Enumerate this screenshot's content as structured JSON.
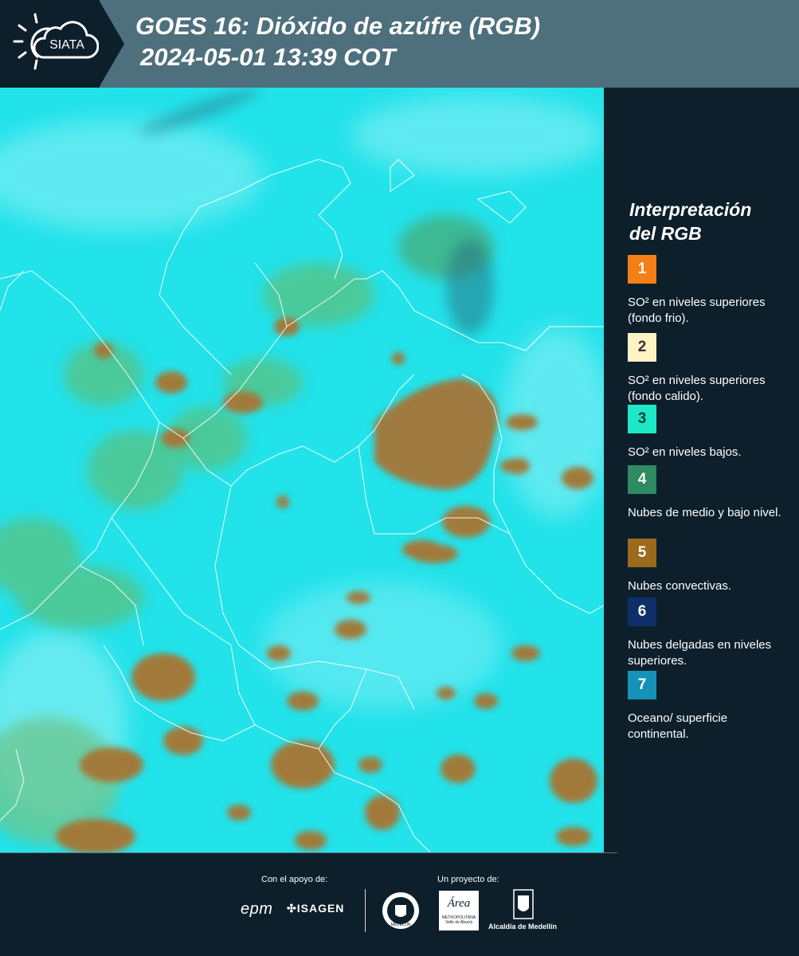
{
  "header": {
    "logo_text": "SIATA",
    "title": "GOES 16: Dióxido de azúfre (RGB)",
    "subtitle": "2024-05-01 13:39 COT"
  },
  "legend": {
    "title_line1": "Interpretación",
    "title_line2": "del RGB",
    "items": [
      {
        "number": "1",
        "color": "#f57f17",
        "text_color": "#ffffff",
        "label": "SO² en niveles superiores (fondo frio)."
      },
      {
        "number": "2",
        "color": "#fff3c4",
        "text_color": "#333333",
        "label": "SO² en niveles superiores (fondo calido)."
      },
      {
        "number": "3",
        "color": "#1de9c8",
        "text_color": "#1a3a3a",
        "label": "SO² en niveles bajos."
      },
      {
        "number": "4",
        "color": "#2e8b62",
        "text_color": "#ffffff",
        "label": "Nubes de medio y bajo nivel."
      },
      {
        "number": "5",
        "color": "#9c6a1c",
        "text_color": "#ffffff",
        "label": "Nubes convectivas."
      },
      {
        "number": "6",
        "color": "#0f2f6b",
        "text_color": "#ffffff",
        "label": "Nubes delgadas en niveles superiores."
      },
      {
        "number": "7",
        "color": "#1592b8",
        "text_color": "#ffffff",
        "label": "Oceano/ superficie continental."
      }
    ]
  },
  "footer": {
    "support_label": "Con el apoyo de:",
    "project_label": "Un proyecto de:",
    "sponsor1": "epm",
    "sponsor2": "ISAGEN",
    "partner1_line1": "Área",
    "partner1_line2": "METROPOLITANA",
    "partner1_line3": "Valle de Aburrá",
    "partner2": "Alcaldía de Medellín",
    "seal_text": "MEDELLÍN"
  },
  "map": {
    "background_color": "#1ee0ea",
    "cloud_color": "#9a7a3c",
    "border_color": "#ffffff"
  }
}
